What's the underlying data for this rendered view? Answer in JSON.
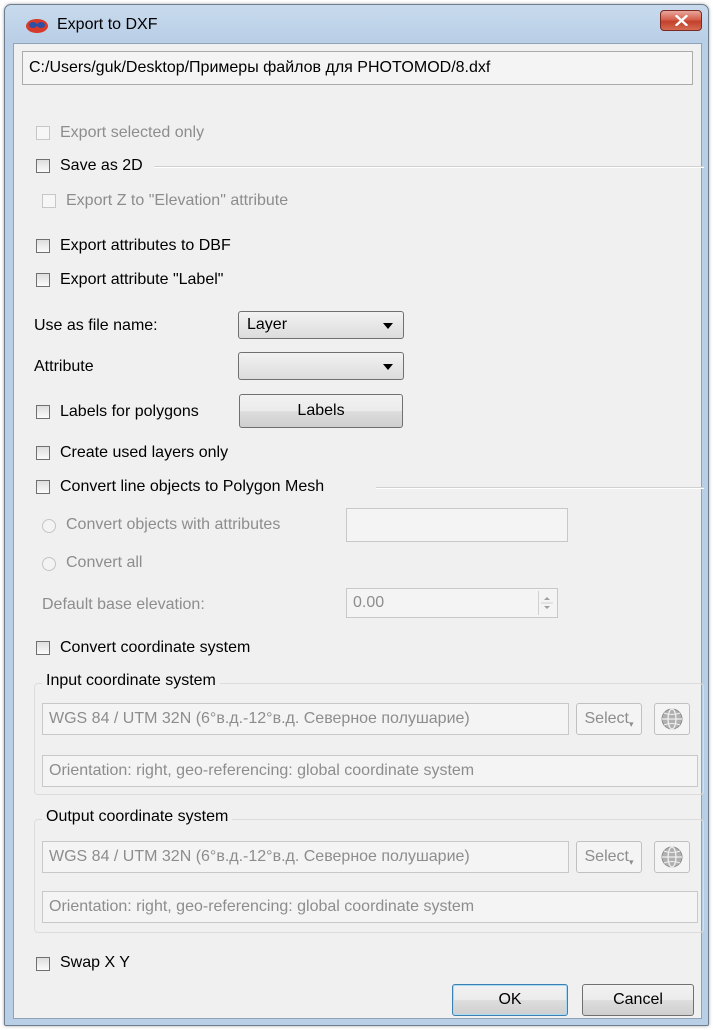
{
  "window": {
    "title": "Export to DXF"
  },
  "file_path": "C:/Users/guk/Desktop/Примеры файлов для PHOTOMOD/8.dxf",
  "options": {
    "export_selected_only": "Export selected only",
    "save_as_2d": "Save as 2D",
    "export_z_elevation": "Export Z to \"Elevation\" attribute",
    "export_attributes_dbf": "Export attributes to DBF",
    "export_attribute_label": "Export attribute \"Label\"",
    "use_as_file_name_label": "Use as file name:",
    "use_as_file_name_value": "Layer",
    "attribute_label": "Attribute",
    "attribute_value": "",
    "labels_for_polygons": "Labels for polygons",
    "labels_button": "Labels",
    "create_used_layers_only": "Create used layers only",
    "convert_line_objects": "Convert line objects to Polygon Mesh",
    "convert_objects_with_attributes": "Convert objects with attributes",
    "convert_objects_value": "",
    "convert_all": "Convert all",
    "default_base_elevation_label": "Default base elevation:",
    "default_base_elevation_value": "0.00",
    "convert_coordinate_system": "Convert coordinate system"
  },
  "input_cs": {
    "title": "Input coordinate system",
    "system": "WGS 84 / UTM 32N (6°в.д.-12°в.д. Северное полушарие)",
    "select_label": "Select",
    "orientation": "Orientation: right, geo-referencing: global coordinate system"
  },
  "output_cs": {
    "title": "Output coordinate system",
    "system": "WGS 84 / UTM 32N (6°в.д.-12°в.д. Северное полушарие)",
    "select_label": "Select",
    "orientation": "Orientation: right, geo-referencing: global coordinate system"
  },
  "swap_xy": "Swap X Y",
  "buttons": {
    "ok": "OK",
    "cancel": "Cancel"
  },
  "colors": {
    "title_bar": "#b9cfe6",
    "close_button": "#c2402b",
    "dialog_background": "#f0f0f0",
    "disabled_text": "#8d8d8d"
  }
}
